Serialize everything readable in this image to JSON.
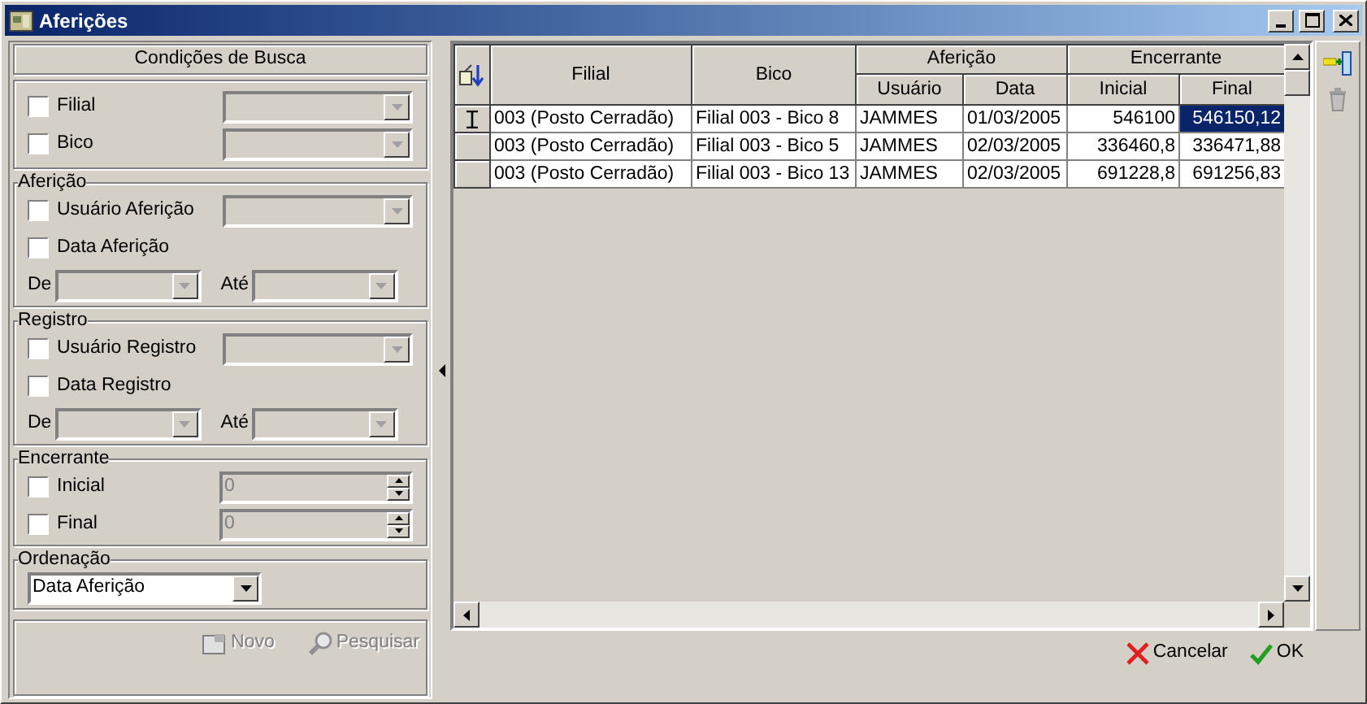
{
  "window": {
    "title": "Aferições"
  },
  "search_panel": {
    "heading": "Condições de Busca",
    "groups": [
      {
        "rows": [
          {
            "kind": "check_combo",
            "label": "Filial",
            "checked": false
          },
          {
            "kind": "check_combo",
            "label": "Bico",
            "checked": false
          }
        ]
      },
      {
        "title": "Aferição",
        "rows": [
          {
            "kind": "check_combo",
            "label": "Usuário Aferição",
            "checked": false
          },
          {
            "kind": "check",
            "label": "Data Aferição",
            "checked": false
          },
          {
            "kind": "range",
            "from_label": "De",
            "to_label": "Até"
          }
        ]
      },
      {
        "title": "Registro",
        "rows": [
          {
            "kind": "check_combo",
            "label": "Usuário Registro",
            "checked": false
          },
          {
            "kind": "check",
            "label": "Data Registro",
            "checked": false
          },
          {
            "kind": "range",
            "from_label": "De",
            "to_label": "Até"
          }
        ]
      },
      {
        "title": "Encerrante",
        "rows": [
          {
            "kind": "check_spin",
            "label": "Inicial",
            "checked": false,
            "value": "0",
            "disabled": true
          },
          {
            "kind": "check_spin",
            "label": "Final",
            "checked": false,
            "value": "0",
            "disabled": true
          }
        ]
      },
      {
        "title": "Ordenação",
        "rows": [
          {
            "kind": "combo",
            "value": "Data Aferição"
          }
        ]
      }
    ],
    "buttons": [
      {
        "kind": "new",
        "label": "Novo",
        "disabled": true
      },
      {
        "kind": "search",
        "label": "Pesquisar",
        "disabled": true
      }
    ]
  },
  "grid": {
    "headers": [
      {
        "label": "Filial"
      },
      {
        "label": "Bico"
      },
      {
        "label": "Aferição",
        "sub_headers": [
          {
            "label": "Usuário"
          },
          {
            "label": "Data"
          }
        ]
      },
      {
        "label": "Encerrante",
        "sub_headers": [
          {
            "label": "Inicial"
          },
          {
            "label": "Final"
          }
        ]
      }
    ],
    "rows": [
      {
        "editing": true,
        "cells": [
          {
            "text": "003 (Posto Cerradão)",
            "selected": false
          },
          {
            "text": "Filial 003 - Bico 8",
            "selected": false
          },
          {
            "text": "JAMMES",
            "selected": false
          },
          {
            "text": "01/03/2005",
            "selected": false
          },
          {
            "text": "546100",
            "selected": false
          },
          {
            "text": "546150,12",
            "selected": true
          }
        ]
      },
      {
        "editing": false,
        "cells": [
          {
            "text": "003 (Posto Cerradão)",
            "selected": false
          },
          {
            "text": "Filial 003 - Bico 5",
            "selected": false
          },
          {
            "text": "JAMMES",
            "selected": false
          },
          {
            "text": "02/03/2005",
            "selected": false
          },
          {
            "text": "336460,8",
            "selected": false
          },
          {
            "text": "336471,88",
            "selected": false
          }
        ]
      },
      {
        "editing": false,
        "cells": [
          {
            "text": "003 (Posto Cerradão)",
            "selected": false
          },
          {
            "text": "Filial 003 - Bico 13",
            "selected": false
          },
          {
            "text": "JAMMES",
            "selected": false
          },
          {
            "text": "02/03/2005",
            "selected": false
          },
          {
            "text": "691228,8",
            "selected": false
          },
          {
            "text": "691256,83",
            "selected": false
          }
        ]
      }
    ]
  },
  "footer_buttons": [
    {
      "kind": "cancel",
      "label": "Cancelar",
      "disabled": false
    },
    {
      "kind": "ok",
      "label": "OK",
      "disabled": false
    }
  ]
}
